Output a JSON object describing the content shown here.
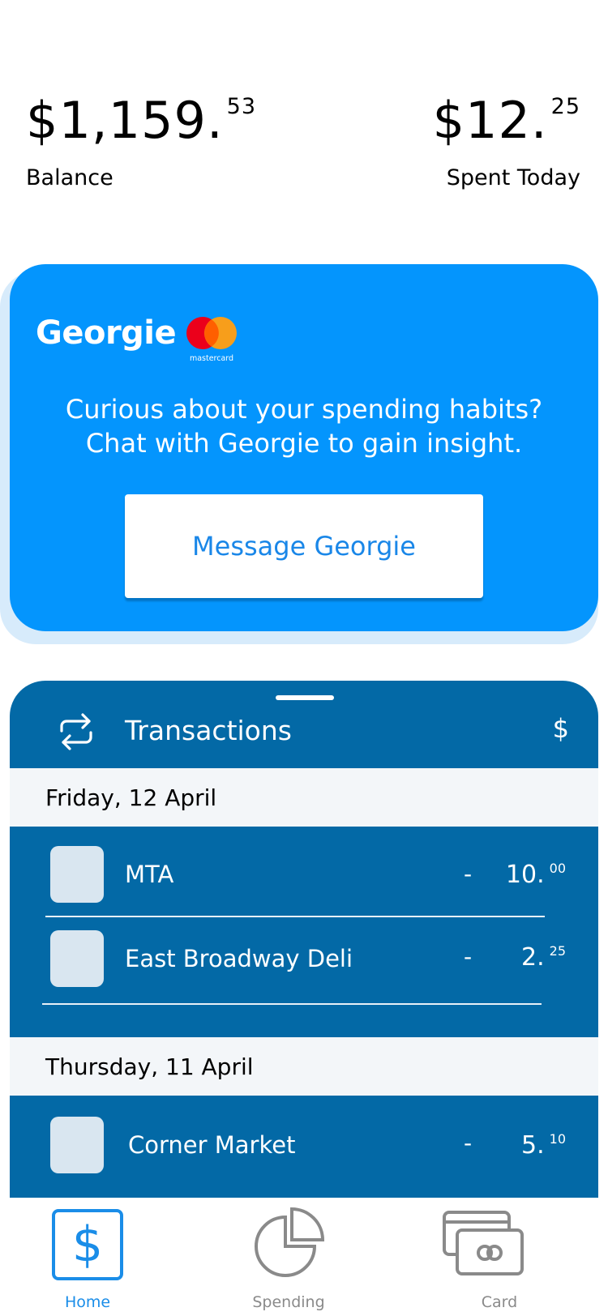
{
  "summary": {
    "balance": {
      "main": "$1,159.",
      "cents": "53",
      "label": "Balance"
    },
    "spent_today": {
      "main": "$12.",
      "cents": "25",
      "label": "Spent Today"
    }
  },
  "promo": {
    "brand": "Georgie",
    "network_logo_text": "mastercard",
    "message_line1": "Curious about your spending habits?",
    "message_line2": "Chat with Georgie to gain insight.",
    "button_label": "Message Georgie",
    "colors": {
      "background": "#0495fd",
      "button_text": "#1a87e8",
      "mc_red": "#eb001b",
      "mc_orange": "#f79e1b"
    }
  },
  "transactions": {
    "title": "Transactions",
    "currency_symbol": "$",
    "groups": [
      {
        "date": "Friday, 12 April",
        "items": [
          {
            "name": "MTA",
            "sign": "-",
            "amount_main": "10.",
            "amount_cents": "00"
          },
          {
            "name": "East Broadway Deli",
            "sign": "-",
            "amount_main": "2.",
            "amount_cents": "25"
          }
        ]
      },
      {
        "date": "Thursday, 11 April",
        "items": [
          {
            "name": "Corner Market",
            "sign": "-",
            "amount_main": "5.",
            "amount_cents": "10"
          }
        ]
      }
    ],
    "colors": {
      "sheet": "#0369a6",
      "date_row": "#f3f6f9"
    }
  },
  "tabbar": {
    "tabs": [
      {
        "label": "Home",
        "icon": "dollar-icon",
        "icon_glyph": "$",
        "active": true
      },
      {
        "label": "Spending",
        "icon": "pie-chart-icon",
        "active": false
      },
      {
        "label": "Card",
        "icon": "cards-icon",
        "active": false
      }
    ],
    "colors": {
      "active": "#1a8de8",
      "inactive": "#8a8a8a"
    }
  }
}
